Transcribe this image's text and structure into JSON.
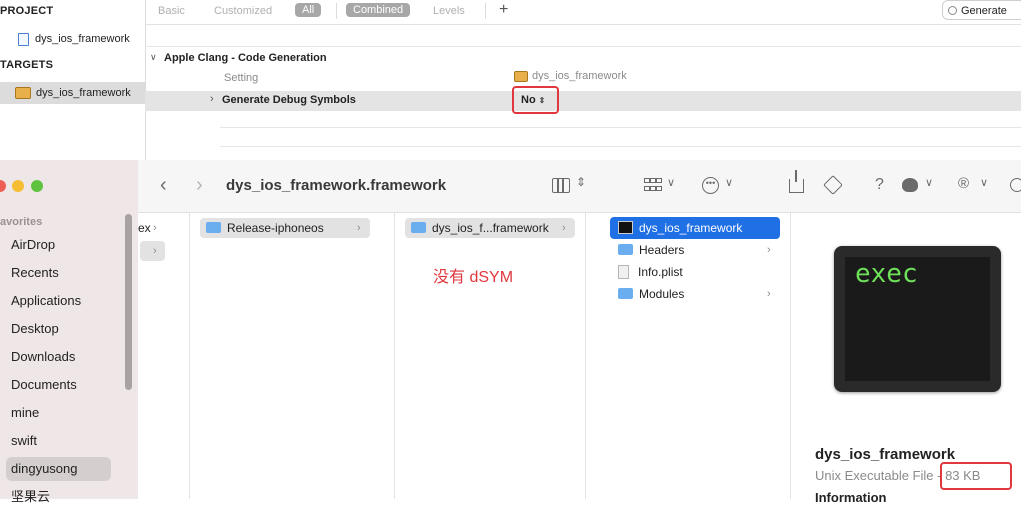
{
  "xcode": {
    "sidebar": {
      "project_header": "PROJECT",
      "project_item": "dys_ios_framework",
      "targets_header": "TARGETS",
      "target_item": "dys_ios_framework"
    },
    "filters": {
      "basic": "Basic",
      "customized": "Customized",
      "all": "All",
      "combined": "Combined",
      "levels": "Levels",
      "add": "+"
    },
    "search": {
      "value": "Generate"
    },
    "section": {
      "title": "Apple Clang - Code Generation",
      "col_setting": "Setting",
      "col_target": "dys_ios_framework",
      "row_name": "Generate Debug Symbols",
      "row_value": "No"
    }
  },
  "finder": {
    "title": "dys_ios_framework.framework",
    "sidebar": {
      "favorites_header": "avorites",
      "items": [
        "AirDrop",
        "Recents",
        "Applications",
        "Desktop",
        "Downloads",
        "Documents",
        "mine",
        "swift",
        "dingyusong",
        "坚果云"
      ]
    },
    "columns": {
      "col0_item": "ex",
      "col1_item": "Release-iphoneos",
      "col2_item": "dys_ios_f...framework",
      "annotation": "没有 dSYM",
      "col3_items": [
        {
          "name": "dys_ios_framework"
        },
        {
          "name": "Headers"
        },
        {
          "name": "Info.plist"
        },
        {
          "name": "Modules"
        }
      ]
    },
    "preview": {
      "icon_text": "exec",
      "name": "dys_ios_framework",
      "kind": "Unix Executable File",
      "separator": " - ",
      "size": "83 KB",
      "info_header": "Information"
    }
  }
}
